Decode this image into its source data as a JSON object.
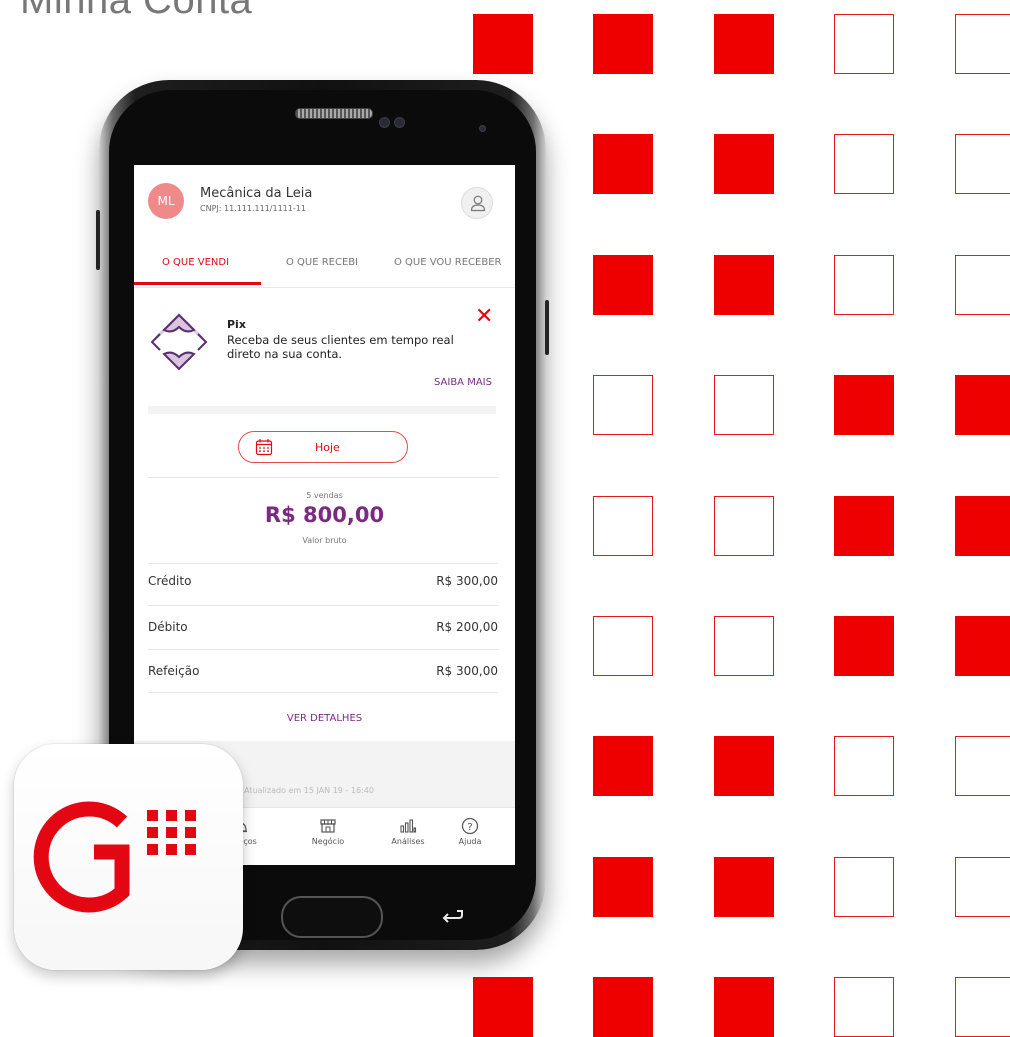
{
  "page": {
    "heading": "Minha Conta"
  },
  "colors": {
    "brand_red": "#ee0000",
    "purple": "#7b2a82",
    "avatar_bg": "#f08a8a"
  },
  "app": {
    "merchant": {
      "initials": "ML",
      "name": "Mecânica da Leia",
      "cnpj": "CNPJ: 11.111.111/1111-11"
    },
    "tabs": [
      {
        "label": "O QUE VENDI",
        "active": true
      },
      {
        "label": "O QUE RECEBI",
        "active": false
      },
      {
        "label": "O QUE VOU RECEBER",
        "active": false
      }
    ],
    "pix_banner": {
      "title": "Pix",
      "description": "Receba de seus clientes em tempo real direto na sua conta.",
      "link": "SAIBA MAIS",
      "close_icon": "close-icon"
    },
    "date_filter": {
      "label": "Hoje",
      "icon": "calendar-icon"
    },
    "summary": {
      "count": "5 vendas",
      "total": "R$ 800,00",
      "caption": "Valor bruto"
    },
    "breakdown": [
      {
        "label": "Crédito",
        "value": "R$ 300,00"
      },
      {
        "label": "Débito",
        "value": "R$ 200,00"
      },
      {
        "label": "Refeição",
        "value": "R$ 300,00"
      }
    ],
    "details_link": "VER DETALHES",
    "updated_text": "Atualizado em 15 JAN 19 - 16:40",
    "bottom_nav": [
      {
        "label": "Serviços",
        "icon": "bell-icon"
      },
      {
        "label": "Negócio",
        "icon": "store-icon"
      },
      {
        "label": "Análises",
        "icon": "bar-chart-icon"
      },
      {
        "label": "Ajuda",
        "icon": "help-icon"
      }
    ]
  }
}
